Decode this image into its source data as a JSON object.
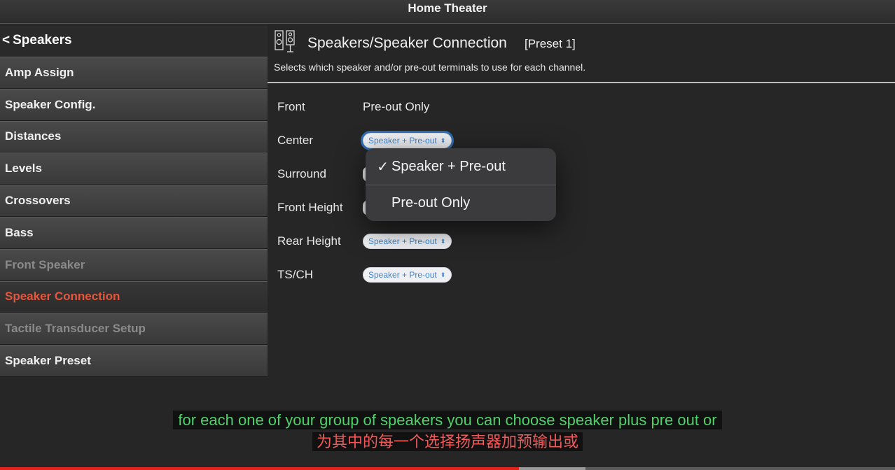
{
  "app": {
    "title": "Home Theater"
  },
  "sidebar": {
    "back_label": "Speakers",
    "back_icon": "chevron-left-icon",
    "items": [
      {
        "label": "Amp Assign",
        "state": "normal"
      },
      {
        "label": "Speaker Config.",
        "state": "normal"
      },
      {
        "label": "Distances",
        "state": "normal"
      },
      {
        "label": "Levels",
        "state": "normal"
      },
      {
        "label": "Crossovers",
        "state": "normal"
      },
      {
        "label": "Bass",
        "state": "normal"
      },
      {
        "label": "Front Speaker",
        "state": "disabled"
      },
      {
        "label": "Speaker Connection",
        "state": "active"
      },
      {
        "label": "Tactile Transducer Setup",
        "state": "disabled"
      },
      {
        "label": "Speaker Preset",
        "state": "normal"
      }
    ]
  },
  "main": {
    "icon": "speakers-icon",
    "title": "Speakers/Speaker Connection",
    "preset": "[Preset 1]",
    "description": "Selects which speaker and/or pre-out terminals to use for each channel.",
    "rows": [
      {
        "label": "Front",
        "value": "Pre-out Only"
      },
      {
        "label": "Center",
        "value": "Speaker + Pre-out"
      },
      {
        "label": "Surround",
        "value": "Speaker + Pre-out"
      },
      {
        "label": "Front Height",
        "value": "Speaker + Pre-out"
      },
      {
        "label": "Rear Height",
        "value": "Speaker + Pre-out"
      },
      {
        "label": "TS/CH",
        "value": "Speaker + Pre-out"
      }
    ]
  },
  "dropdown": {
    "options": [
      {
        "label": "Speaker + Pre-out",
        "selected": true
      },
      {
        "label": "Pre-out Only",
        "selected": false
      }
    ]
  },
  "subtitles": {
    "english": "for each one of your group of speakers you can choose speaker plus pre out or",
    "chinese": "为其中的每一个选择扬声器加预输出或"
  },
  "video_progress": {
    "played_fraction": 0.58,
    "buffered_fraction": 0.654
  },
  "colors": {
    "active_item": "#e8553a",
    "accent_blue": "#3b86d6",
    "subtitle_en": "#4fd16a",
    "subtitle_zh": "#ef5b5b",
    "progress_played": "#e0241b"
  }
}
